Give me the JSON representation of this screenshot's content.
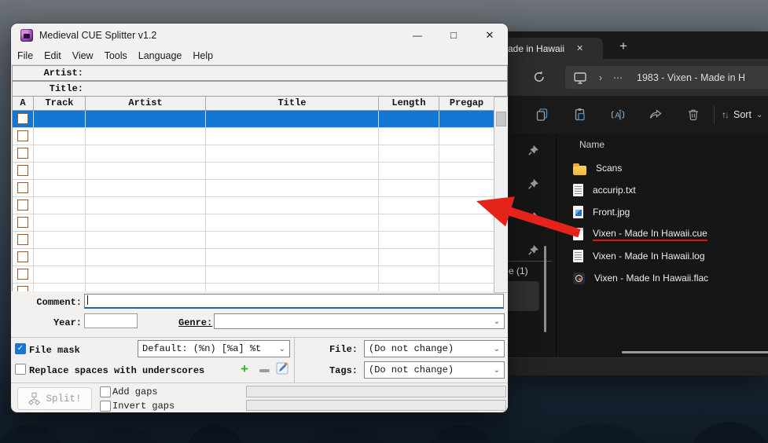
{
  "cue_splitter": {
    "window_title": "Medieval CUE Splitter v1.2",
    "window_controls": {
      "minimize": "—",
      "maximize": "□",
      "close": "✕"
    },
    "menu_items": [
      "File",
      "Edit",
      "View",
      "Tools",
      "Language",
      "Help"
    ],
    "artist_label": "Artist:",
    "title_label": "Title:",
    "table": {
      "columns": [
        "A",
        "Track",
        "Artist",
        "Title",
        "Length",
        "Pregap"
      ],
      "rows": 11,
      "selected_row_index": 0
    },
    "comment_label": "Comment:",
    "year_label": "Year:",
    "genre_label": "Genre:",
    "file_mask_label": "File mask",
    "mask_preset": "Default: (%n) [%a] %t",
    "replace_spaces_label": "Replace spaces with underscores",
    "file_label": "File:",
    "file_value": "(Do not change)",
    "tags_label": "Tags:",
    "tags_value": "(Do not change)",
    "split_label": "Split!",
    "add_gaps_label": "Add gaps",
    "invert_gaps_label": "Invert gaps",
    "glyphs": {
      "dropdown_chevron": "⌄",
      "add": "+",
      "check": "✓"
    }
  },
  "explorer": {
    "tab_title": "ade in Hawaii",
    "new_tab": "+",
    "address_text": "1983 - Vixen - Made in H",
    "sort_label": "Sort",
    "list_header": "Name",
    "sidebar_fragment": "e (1)",
    "files": [
      {
        "name": "Scans",
        "type": "folder"
      },
      {
        "name": "accurip.txt",
        "type": "txt"
      },
      {
        "name": "Front.jpg",
        "type": "image"
      },
      {
        "name": "Vixen - Made In Hawaii.cue",
        "type": "cue",
        "underlined": true
      },
      {
        "name": "Vixen - Made In Hawaii.log",
        "type": "txt"
      },
      {
        "name": "Vixen - Made In Hawaii.flac",
        "type": "flac"
      }
    ],
    "glyphs": {
      "tab_close": "✕",
      "breadcrumb_chevron": "›",
      "ellipsis": "⋯",
      "sort_chevron": "⌄"
    }
  },
  "annotations": {
    "arrow_color": "#e5231b",
    "underline_color": "#e11414"
  },
  "colors": {
    "selection_blue": "#1277d4",
    "focus_underline": "#1e63b4",
    "checkbox_brown": "#9a5b2e"
  }
}
